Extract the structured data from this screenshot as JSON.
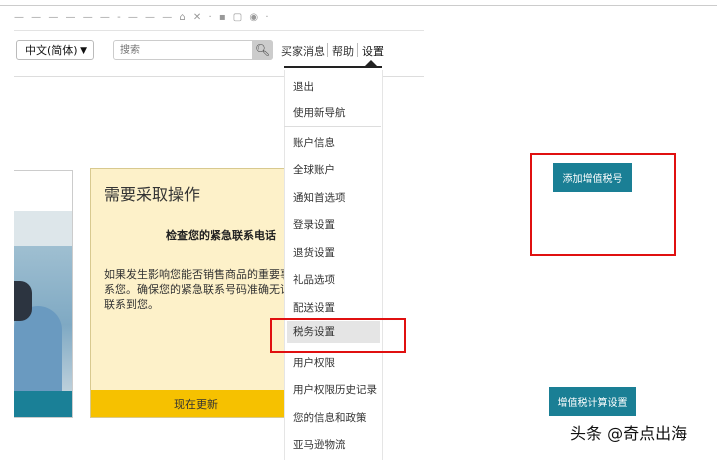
{
  "browser": {
    "tab_text": "— — — — — — - — — — ⌂ ✕ · ▪ ▢ ◉ ·"
  },
  "header": {
    "language": "中文(简体)",
    "search_placeholder": "搜索",
    "links": [
      "买家消息",
      "帮助",
      "设置"
    ]
  },
  "menu": {
    "items": [
      "退出",
      "使用新导航",
      "账户信息",
      "全球账户",
      "通知首选项",
      "登录设置",
      "退货设置",
      "礼品选项",
      "配送设置",
      "税务设置",
      "用户权限",
      "用户权限历史记录",
      "您的信息和政策",
      "亚马逊物流"
    ],
    "highlighted": "税务设置"
  },
  "action_card": {
    "title": "需要采取操作",
    "subtitle": "检查您的紧急联系电话",
    "body": "如果发生影响您能否销售商品的重要事件，我们会联系您。确保您的紧急联系号码准确无误，有助于我们联系到您。",
    "button": "现在更新"
  },
  "tax": {
    "add_vat_button": "添加增值税号",
    "vat_calc_button": "增值税计算设置"
  },
  "watermark": "头条 @奇点出海",
  "colors": {
    "teal": "#1a7f95",
    "yellow": "#f6c100",
    "highlight_red": "#e01010"
  }
}
